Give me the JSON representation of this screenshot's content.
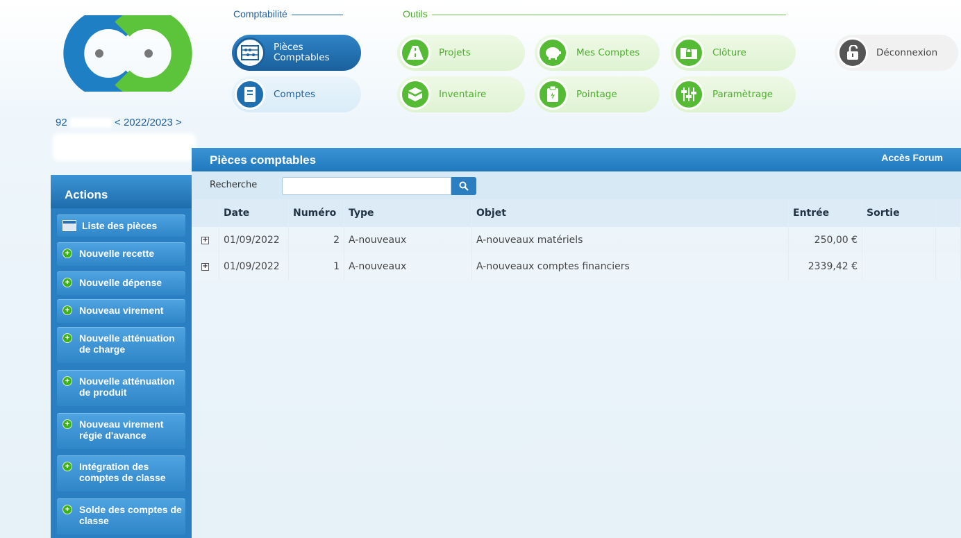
{
  "header": {
    "org_prefix": "92",
    "exercise": "< 2022/2023 >",
    "compta_group": "Comptabilité",
    "outils_group": "Outils"
  },
  "nav": {
    "pieces": "Pièces Comptables",
    "comptes": "Comptes",
    "projets": "Projets",
    "inventaire": "Inventaire",
    "mes_comptes": "Mes Comptes",
    "pointage": "Pointage",
    "cloture": "Clôture",
    "parametrage": "Paramètrage",
    "deconnexion": "Déconnexion"
  },
  "sidebar": {
    "title": "Actions",
    "items": [
      "Liste des pièces",
      "Nouvelle recette",
      "Nouvelle dépense",
      "Nouveau virement",
      "Nouvelle atténuation de charge",
      "Nouvelle atténuation de produit",
      "Nouveau virement régie d'avance",
      "Intégration des comptes de classe",
      "Solde des comptes de classe"
    ]
  },
  "panel": {
    "title": "Pièces comptables",
    "forum_link": "Accès Forum",
    "search_label": "Recherche",
    "search_value": ""
  },
  "table": {
    "columns": [
      "Date",
      "Numéro",
      "Type",
      "Objet",
      "Entrée",
      "Sortie"
    ],
    "rows": [
      {
        "date": "01/09/2022",
        "numero": "2",
        "type": "A-nouveaux",
        "objet": "A-nouveaux matériels",
        "entree": "250,00 €",
        "sortie": ""
      },
      {
        "date": "01/09/2022",
        "numero": "1",
        "type": "A-nouveaux",
        "objet": "A-nouveaux comptes financiers",
        "entree": "2339,42 €",
        "sortie": ""
      }
    ]
  },
  "colors": {
    "primary_blue": "#2a7fc2",
    "accent_green": "#55bb34",
    "logo_blue": "#1f7fc4",
    "logo_green": "#5cc43a"
  },
  "icons": {
    "pieces": "abacus-icon",
    "comptes": "address-book-icon",
    "projets": "road-icon",
    "inventaire": "box-icon",
    "mes_comptes": "piggy-bank-icon",
    "pointage": "clipboard-icon",
    "cloture": "locked-folder-icon",
    "parametrage": "sliders-icon",
    "deconnexion": "unlock-icon",
    "search": "search-icon"
  }
}
